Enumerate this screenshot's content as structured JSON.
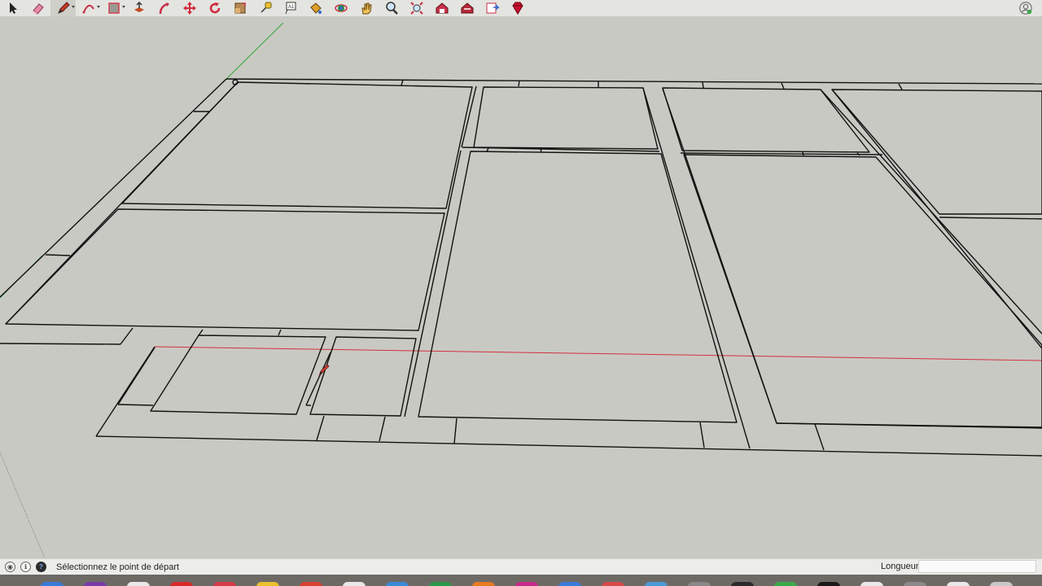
{
  "toolbar": {
    "tools": [
      {
        "name": "select-tool-icon",
        "shape": "arrow"
      },
      {
        "name": "eraser-tool-icon",
        "shape": "eraser"
      },
      {
        "name": "line-tool-icon",
        "shape": "pencil",
        "active": true,
        "caret": true
      },
      {
        "name": "arc-tool-icon",
        "shape": "arc",
        "caret": true
      },
      {
        "name": "rectangle-tool-icon",
        "shape": "rect",
        "caret": true
      },
      {
        "name": "push-pull-tool-icon",
        "shape": "pushpull"
      },
      {
        "name": "follow-me-tool-icon",
        "shape": "followme"
      },
      {
        "name": "move-tool-icon",
        "shape": "move"
      },
      {
        "name": "rotate-tool-icon",
        "shape": "rotate"
      },
      {
        "name": "scale-tool-icon",
        "shape": "scale"
      },
      {
        "name": "tape-measure-tool-icon",
        "shape": "tape"
      },
      {
        "name": "text-tool-icon",
        "shape": "text"
      },
      {
        "name": "paint-bucket-tool-icon",
        "shape": "bucket"
      },
      {
        "name": "orbit-tool-icon",
        "shape": "orbit"
      },
      {
        "name": "pan-tool-icon",
        "shape": "hand"
      },
      {
        "name": "zoom-tool-icon",
        "shape": "zoom"
      },
      {
        "name": "zoom-extents-tool-icon",
        "shape": "extents"
      },
      {
        "name": "3d-warehouse-icon",
        "shape": "warehouse"
      },
      {
        "name": "extension-warehouse-icon",
        "shape": "extwarehouse"
      },
      {
        "name": "send-to-layout-icon",
        "shape": "layout"
      },
      {
        "name": "extension-manager-icon",
        "shape": "ruby"
      }
    ],
    "profile_icon": "profile-icon"
  },
  "status_bar": {
    "message": "Sélectionnez le point de départ",
    "vcb_label": "Longueur",
    "vcb_value": ""
  },
  "colors": {
    "viewport_bg": "#c9c9c3",
    "edges": "#111111",
    "red_axis": "#d23040",
    "green_axis": "#2fa83a",
    "toolbar_bg": "#e4e4e0"
  }
}
